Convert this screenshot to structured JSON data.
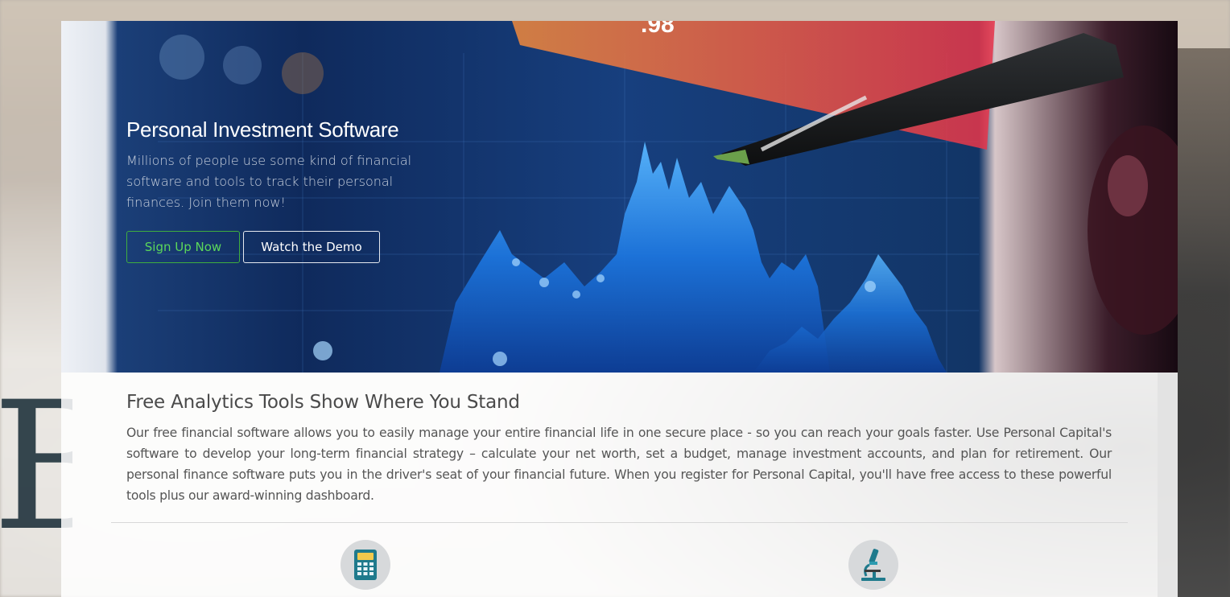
{
  "hero": {
    "title": "Personal Investment Software",
    "subtitle": "Millions of people use some kind of financial software and tools to track their personal finances. Join them now!",
    "signup_label": "Sign Up Now",
    "demo_label": "Watch the Demo",
    "background_readout": ".98",
    "colors": {
      "signup_border": "#3fae3f",
      "signup_text": "#5bd75b",
      "chart_blue": "#1f78e0"
    }
  },
  "section": {
    "heading": "Free Analytics Tools Show Where You Stand",
    "body": "Our free financial software allows you to easily manage your entire financial life in one secure place - so you can reach your goals faster. Use Personal Capital's software to develop your long-term financial strategy – calculate your net worth, set a budget, manage investment accounts, and plan for retirement. Our personal finance software puts you in the driver's seat of your financial future. When you register for Personal Capital, you'll have free access to these powerful tools plus our award-winning dashboard."
  },
  "features": [
    {
      "icon": "calculator-icon"
    },
    {
      "icon": "microscope-icon"
    }
  ]
}
